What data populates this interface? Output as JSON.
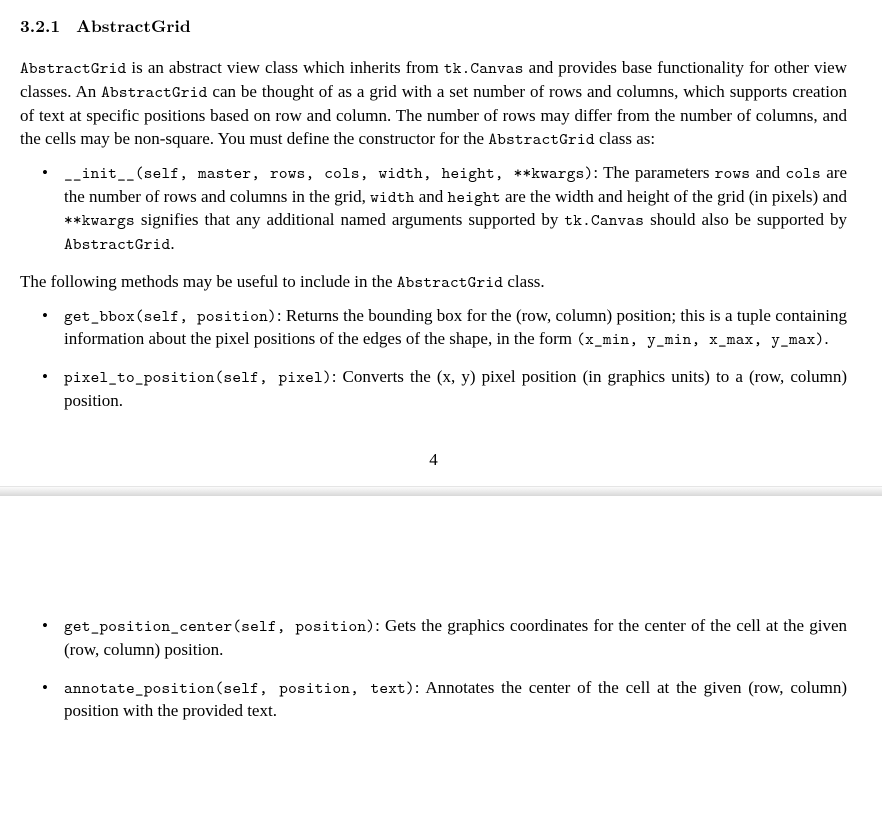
{
  "section": {
    "number": "3.2.1",
    "title": "AbstractGrid"
  },
  "intro": {
    "code1": "AbstractGrid",
    "t1": " is an abstract view class which inherits from ",
    "code2": "tk.Canvas",
    "t2": " and provides base functionality for other view classes. An ",
    "code3": "AbstractGrid",
    "t3": " can be thought of as a grid with a set number of rows and columns, which supports creation of text at specific positions based on row and column. The number of rows may differ from the number of columns, and the cells may be non-square. You must define the constructor for the ",
    "code4": "AbstractGrid",
    "t4": " class as:"
  },
  "ctor": {
    "sig": "__init__(self, master, rows, cols, width, height, **kwargs)",
    "d1": ": The parameters ",
    "c_rows": "rows",
    "d2": " and ",
    "c_cols": "cols",
    "d3": " are the number of rows and columns in the grid, ",
    "c_width": "width",
    "d4": " and ",
    "c_height": "height",
    "d5": " are the width and height of the grid (in pixels) and ",
    "c_kw": "**kwargs",
    "d6": " signifies that any additional named arguments supported by ",
    "c_canvas": "tk.Canvas",
    "d7": " should also be supported by ",
    "c_ag": "AbstractGrid",
    "d8": "."
  },
  "midline": {
    "t1": "The following methods may be useful to include in the ",
    "code": "AbstractGrid",
    "t2": " class."
  },
  "methods1": {
    "bbox_sig": "get_bbox(self, position)",
    "bbox_d1": ": Returns the bounding box for the (row, column) position; this is a tuple containing information about the pixel positions of the edges of the shape, in the form ",
    "bbox_tuple": "(x_min, y_min, x_max, y_max)",
    "bbox_d2": ".",
    "p2p_sig": "pixel_to_position(self, pixel)",
    "p2p_d": ": Converts the (x, y) pixel position (in graphics units) to a (row, column) position."
  },
  "pagenum": "4",
  "methods2": {
    "gpc_sig": "get_position_center(self, position)",
    "gpc_d": ": Gets the graphics coordinates for the center of the cell at the given (row, column) position.",
    "ann_sig": "annotate_position(self, position, text)",
    "ann_d": ": Annotates the center of the cell at the given (row, column) position with the provided text."
  }
}
